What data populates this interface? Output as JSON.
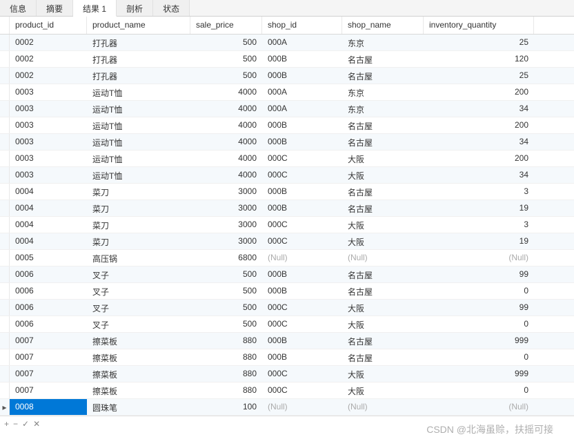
{
  "tabs": [
    {
      "label": "信息",
      "active": false
    },
    {
      "label": "摘要",
      "active": false
    },
    {
      "label": "结果 1",
      "active": true
    },
    {
      "label": "剖析",
      "active": false
    },
    {
      "label": "状态",
      "active": false
    }
  ],
  "columns": [
    {
      "key": "product_id",
      "label": "product_id",
      "align": "left"
    },
    {
      "key": "product_name",
      "label": "product_name",
      "align": "left"
    },
    {
      "key": "sale_price",
      "label": "sale_price",
      "align": "right"
    },
    {
      "key": "shop_id",
      "label": "shop_id",
      "align": "left"
    },
    {
      "key": "shop_name",
      "label": "shop_name",
      "align": "left"
    },
    {
      "key": "inventory_quantity",
      "label": "inventory_quantity",
      "align": "right"
    }
  ],
  "null_label": "(Null)",
  "rows": [
    {
      "product_id": "0002",
      "product_name": "打孔器",
      "sale_price": 500,
      "shop_id": "000A",
      "shop_name": "东京",
      "inventory_quantity": 25
    },
    {
      "product_id": "0002",
      "product_name": "打孔器",
      "sale_price": 500,
      "shop_id": "000B",
      "shop_name": "名古屋",
      "inventory_quantity": 120
    },
    {
      "product_id": "0002",
      "product_name": "打孔器",
      "sale_price": 500,
      "shop_id": "000B",
      "shop_name": "名古屋",
      "inventory_quantity": 25
    },
    {
      "product_id": "0003",
      "product_name": "运动T恤",
      "sale_price": 4000,
      "shop_id": "000A",
      "shop_name": "东京",
      "inventory_quantity": 200
    },
    {
      "product_id": "0003",
      "product_name": "运动T恤",
      "sale_price": 4000,
      "shop_id": "000A",
      "shop_name": "东京",
      "inventory_quantity": 34
    },
    {
      "product_id": "0003",
      "product_name": "运动T恤",
      "sale_price": 4000,
      "shop_id": "000B",
      "shop_name": "名古屋",
      "inventory_quantity": 200
    },
    {
      "product_id": "0003",
      "product_name": "运动T恤",
      "sale_price": 4000,
      "shop_id": "000B",
      "shop_name": "名古屋",
      "inventory_quantity": 34
    },
    {
      "product_id": "0003",
      "product_name": "运动T恤",
      "sale_price": 4000,
      "shop_id": "000C",
      "shop_name": "大阪",
      "inventory_quantity": 200
    },
    {
      "product_id": "0003",
      "product_name": "运动T恤",
      "sale_price": 4000,
      "shop_id": "000C",
      "shop_name": "大阪",
      "inventory_quantity": 34
    },
    {
      "product_id": "0004",
      "product_name": "菜刀",
      "sale_price": 3000,
      "shop_id": "000B",
      "shop_name": "名古屋",
      "inventory_quantity": 3
    },
    {
      "product_id": "0004",
      "product_name": "菜刀",
      "sale_price": 3000,
      "shop_id": "000B",
      "shop_name": "名古屋",
      "inventory_quantity": 19
    },
    {
      "product_id": "0004",
      "product_name": "菜刀",
      "sale_price": 3000,
      "shop_id": "000C",
      "shop_name": "大阪",
      "inventory_quantity": 3
    },
    {
      "product_id": "0004",
      "product_name": "菜刀",
      "sale_price": 3000,
      "shop_id": "000C",
      "shop_name": "大阪",
      "inventory_quantity": 19
    },
    {
      "product_id": "0005",
      "product_name": "高压锅",
      "sale_price": 6800,
      "shop_id": null,
      "shop_name": null,
      "inventory_quantity": null
    },
    {
      "product_id": "0006",
      "product_name": "叉子",
      "sale_price": 500,
      "shop_id": "000B",
      "shop_name": "名古屋",
      "inventory_quantity": 99
    },
    {
      "product_id": "0006",
      "product_name": "叉子",
      "sale_price": 500,
      "shop_id": "000B",
      "shop_name": "名古屋",
      "inventory_quantity": 0
    },
    {
      "product_id": "0006",
      "product_name": "叉子",
      "sale_price": 500,
      "shop_id": "000C",
      "shop_name": "大阪",
      "inventory_quantity": 99
    },
    {
      "product_id": "0006",
      "product_name": "叉子",
      "sale_price": 500,
      "shop_id": "000C",
      "shop_name": "大阪",
      "inventory_quantity": 0
    },
    {
      "product_id": "0007",
      "product_name": "擦菜板",
      "sale_price": 880,
      "shop_id": "000B",
      "shop_name": "名古屋",
      "inventory_quantity": 999
    },
    {
      "product_id": "0007",
      "product_name": "擦菜板",
      "sale_price": 880,
      "shop_id": "000B",
      "shop_name": "名古屋",
      "inventory_quantity": 0
    },
    {
      "product_id": "0007",
      "product_name": "擦菜板",
      "sale_price": 880,
      "shop_id": "000C",
      "shop_name": "大阪",
      "inventory_quantity": 999
    },
    {
      "product_id": "0007",
      "product_name": "擦菜板",
      "sale_price": 880,
      "shop_id": "000C",
      "shop_name": "大阪",
      "inventory_quantity": 0
    },
    {
      "product_id": "0008",
      "product_name": "圆珠笔",
      "sale_price": 100,
      "shop_id": null,
      "shop_name": null,
      "inventory_quantity": null,
      "selected": true
    }
  ],
  "footer": {
    "add": "+",
    "remove": "−",
    "apply": "✓",
    "cancel": "✕"
  },
  "watermark": "CSDN @北海虽赊，扶摇可接"
}
